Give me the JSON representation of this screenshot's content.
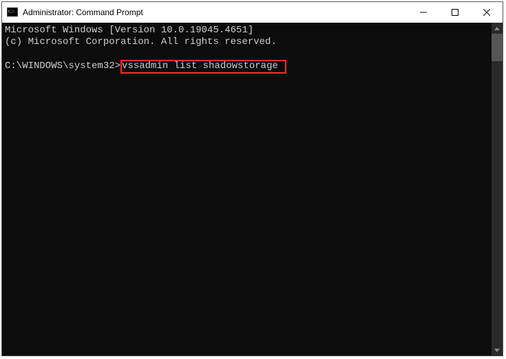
{
  "window": {
    "title": "Administrator: Command Prompt"
  },
  "terminal": {
    "line1": "Microsoft Windows [Version 10.0.19045.4651]",
    "line2": "(c) Microsoft Corporation. All rights reserved.",
    "blank": "",
    "prompt": "C:\\WINDOWS\\system32>",
    "command": "vssadmin list shadowstorage"
  }
}
